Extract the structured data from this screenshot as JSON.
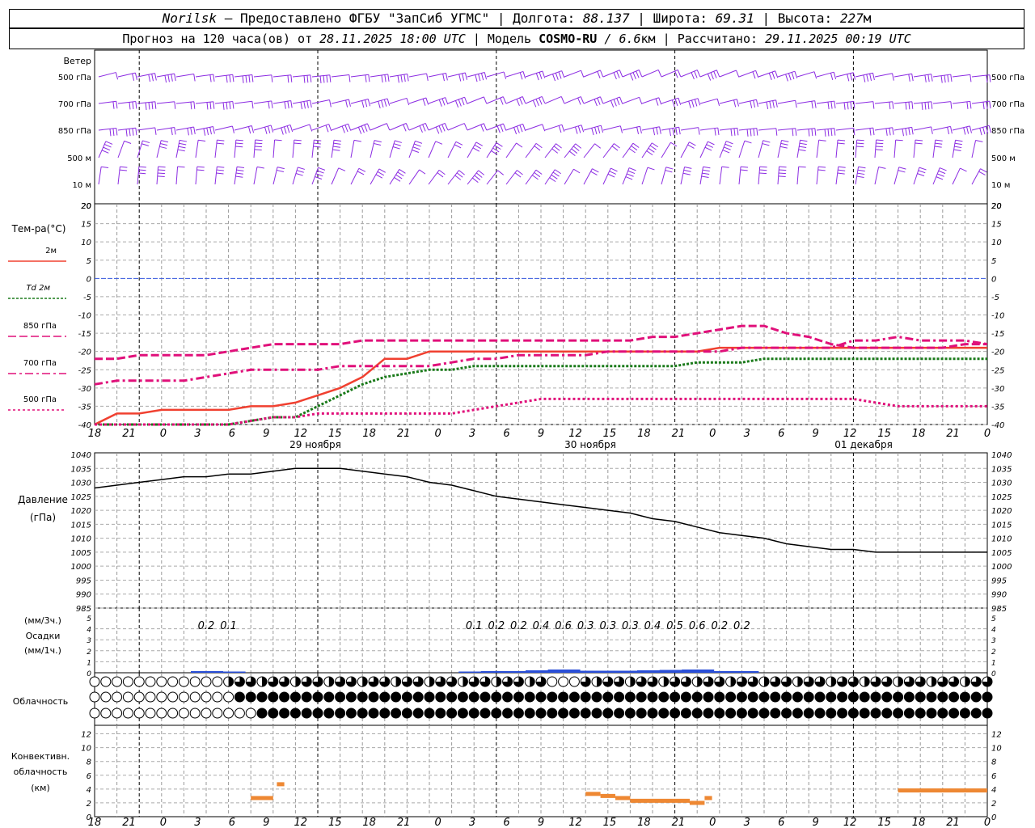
{
  "header": {
    "location": "Norilsk",
    "provider": "– Предоставлено ФГБУ \"ЗапСиб УГМС\"",
    "lon_label": "Долгота:",
    "lon_value": "88.137",
    "lat_label": "Широта:",
    "lat_value": "69.31",
    "alt_label": "Высота:",
    "alt_value": "227",
    "alt_unit": "м",
    "sep": "|"
  },
  "subheader": {
    "forecast_label": "Прогноз на 120 часа(ов) от",
    "forecast_start": "28.11.2025 18:00 UTC",
    "model_label": "Модель",
    "model_name": "COSMO-RU",
    "model_res_sep": "/",
    "model_res": "6.6",
    "model_res_unit": "км",
    "calc_label": "Рассчитано:",
    "calc_time": "29.11.2025 00:19 UTC",
    "sep": "|"
  },
  "time_axis": {
    "ticks": [
      "18",
      "21",
      "0",
      "3",
      "6",
      "9",
      "12",
      "15",
      "18",
      "21",
      "0",
      "3",
      "6",
      "9",
      "12",
      "15",
      "18",
      "21",
      "0",
      "3",
      "6",
      "9",
      "12",
      "15",
      "18",
      "21",
      "0"
    ],
    "dates": [
      "29 ноября",
      "30 ноября",
      "01 декабря"
    ]
  },
  "wind_panel": {
    "title": "Ветер",
    "levels": [
      "500 гПа",
      "700 гПа",
      "850 гПа",
      "500 м",
      "10 м"
    ],
    "color": "#8b2be2"
  },
  "temp_panel": {
    "title": "Тем-ра(°C)",
    "legend": [
      {
        "label": "2м",
        "color": "#f04030"
      },
      {
        "label": "Td  2м",
        "color": "#1a7a1a"
      },
      {
        "label": "850 гПа",
        "color": "#e0107a"
      },
      {
        "label": "700 гПа",
        "color": "#e0107a"
      },
      {
        "label": "500 гПа",
        "color": "#e0107a"
      }
    ],
    "ticks": [
      "20",
      "15",
      "10",
      "5",
      "0",
      "-5",
      "-10",
      "-15",
      "-20",
      "-25",
      "-30",
      "-35",
      "-40"
    ]
  },
  "pressure_panel": {
    "title1": "Давление",
    "title2": "(гПа)",
    "ticks": [
      "1040",
      "1035",
      "1030",
      "1025",
      "1020",
      "1015",
      "1010",
      "1005",
      "1000",
      "995",
      "990",
      "985"
    ]
  },
  "precip_panel": {
    "title1": "(мм/3ч.)",
    "title2": "Осадки",
    "title3": "(мм/1ч.)",
    "ticks": [
      "5",
      "4",
      "3",
      "2",
      "1",
      "0",
      "5",
      "4",
      "3",
      "2",
      "1",
      "0"
    ],
    "amounts": [
      "0.2",
      "0.1",
      "0.1",
      "0.2",
      "0.2",
      "0.4",
      "0.6",
      "0.3",
      "0.3",
      "0.3",
      "0.4",
      "0.5",
      "0.6",
      "0.2",
      "0.2"
    ]
  },
  "cloud_panel": {
    "title": "Облачность"
  },
  "conv_panel": {
    "title1": "Конвективн.",
    "title2": "облачность",
    "title3": "(км)",
    "ticks": [
      "12",
      "10",
      "8",
      "6",
      "4",
      "2",
      "0"
    ],
    "color": "#ee8833"
  },
  "chart_data": [
    {
      "type": "line",
      "name": "Тем-ра(°C)",
      "ylim": [
        -40,
        20
      ],
      "x_hours_from_start": [
        0,
        3,
        6,
        9,
        12,
        15,
        18,
        21,
        24,
        27,
        30,
        33,
        36,
        39,
        42,
        45,
        48,
        51,
        54,
        57,
        60,
        63,
        66,
        69,
        72,
        75,
        78,
        81,
        84,
        87,
        90,
        93,
        96,
        99,
        102,
        105,
        108,
        111,
        114,
        117,
        120
      ],
      "series": [
        {
          "name": "2м",
          "values": [
            -40,
            -37,
            -37,
            -36,
            -36,
            -36,
            -36,
            -35,
            -35,
            -34,
            -32,
            -30,
            -27,
            -22,
            -22,
            -20,
            -20,
            -20,
            -20,
            -20,
            -20,
            -20,
            -20,
            -20,
            -20,
            -20,
            -20,
            -20,
            -19,
            -19,
            -19,
            -19,
            -19,
            -19,
            -19,
            -19,
            -19,
            -19,
            -19,
            -19,
            -19
          ]
        },
        {
          "name": "Td  2м",
          "values": [
            -40,
            -40,
            -40,
            -40,
            -40,
            -40,
            -40,
            -39,
            -38,
            -38,
            -35,
            -32,
            -29,
            -27,
            -26,
            -25,
            -25,
            -24,
            -24,
            -24,
            -24,
            -24,
            -24,
            -24,
            -24,
            -24,
            -24,
            -23,
            -23,
            -23,
            -22,
            -22,
            -22,
            -22,
            -22,
            -22,
            -22,
            -22,
            -22,
            -22,
            -22
          ]
        },
        {
          "name": "850 гПа",
          "values": [
            -22,
            -22,
            -21,
            -21,
            -21,
            -21,
            -20,
            -19,
            -18,
            -18,
            -18,
            -18,
            -17,
            -17,
            -17,
            -17,
            -17,
            -17,
            -17,
            -17,
            -17,
            -17,
            -17,
            -17,
            -17,
            -16,
            -16,
            -15,
            -14,
            -13,
            -13,
            -15,
            -16,
            -18,
            -19,
            -19,
            -19,
            -19,
            -19,
            -18,
            -18
          ]
        },
        {
          "name": "700 гПа",
          "values": [
            -29,
            -28,
            -28,
            -28,
            -28,
            -27,
            -26,
            -25,
            -25,
            -25,
            -25,
            -24,
            -24,
            -24,
            -24,
            -24,
            -23,
            -22,
            -22,
            -21,
            -21,
            -21,
            -21,
            -20,
            -20,
            -20,
            -20,
            -20,
            -20,
            -19,
            -19,
            -19,
            -19,
            -19,
            -17,
            -17,
            -16,
            -17,
            -17,
            -17,
            -18
          ]
        },
        {
          "name": "500 гПа",
          "values": [
            -40,
            -40,
            -40,
            -40,
            -40,
            -40,
            -40,
            -39,
            -38,
            -38,
            -37,
            -37,
            -37,
            -37,
            -37,
            -37,
            -37,
            -36,
            -35,
            -34,
            -33,
            -33,
            -33,
            -33,
            -33,
            -33,
            -33,
            -33,
            -33,
            -33,
            -33,
            -33,
            -33,
            -33,
            -33,
            -34,
            -35,
            -35,
            -35,
            -35,
            -35
          ]
        }
      ]
    },
    {
      "type": "line",
      "name": "Давление (гПа)",
      "ylim": [
        985,
        1040
      ],
      "x_hours_from_start": [
        0,
        3,
        6,
        9,
        12,
        15,
        18,
        21,
        24,
        27,
        30,
        33,
        36,
        39,
        42,
        45,
        48,
        51,
        54,
        57,
        60,
        63,
        66,
        69,
        72,
        75,
        78,
        81,
        84,
        87,
        90,
        93,
        96,
        99,
        102,
        105,
        108,
        111,
        114,
        117,
        120
      ],
      "series": [
        {
          "name": "Давление",
          "values": [
            1028,
            1029,
            1030,
            1031,
            1032,
            1032,
            1033,
            1033,
            1034,
            1035,
            1035,
            1035,
            1034,
            1033,
            1032,
            1030,
            1029,
            1027,
            1025,
            1024,
            1023,
            1022,
            1021,
            1020,
            1019,
            1017,
            1016,
            1014,
            1012,
            1011,
            1010,
            1008,
            1007,
            1006,
            1006,
            1005,
            1005,
            1005,
            1005,
            1005,
            1005
          ]
        }
      ]
    },
    {
      "type": "bar",
      "name": "Осадки (мм/3ч.)",
      "ylim": [
        0,
        5
      ],
      "labeled_hours": [
        15,
        18,
        51,
        54,
        57,
        60,
        63,
        66,
        69,
        72,
        75,
        78,
        81,
        84,
        87
      ],
      "values": [
        0.2,
        0.1,
        0.1,
        0.2,
        0.2,
        0.4,
        0.6,
        0.3,
        0.3,
        0.3,
        0.4,
        0.5,
        0.6,
        0.2,
        0.2
      ]
    },
    {
      "type": "bar",
      "name": "Конвективн. облачность (км)",
      "ylim": [
        0,
        13
      ],
      "segments": [
        {
          "from_hour": 21,
          "to_hour": 24,
          "km": 2.7
        },
        {
          "from_hour": 24.5,
          "to_hour": 25.5,
          "km": 4.7
        },
        {
          "from_hour": 66,
          "to_hour": 68,
          "km": 3.3
        },
        {
          "from_hour": 68,
          "to_hour": 70,
          "km": 3.0
        },
        {
          "from_hour": 70,
          "to_hour": 72,
          "km": 2.7
        },
        {
          "from_hour": 72,
          "to_hour": 80,
          "km": 2.3
        },
        {
          "from_hour": 80,
          "to_hour": 82,
          "km": 2.0
        },
        {
          "from_hour": 82,
          "to_hour": 83,
          "km": 2.7
        },
        {
          "from_hour": 108,
          "to_hour": 120,
          "km": 3.8
        }
      ]
    }
  ]
}
